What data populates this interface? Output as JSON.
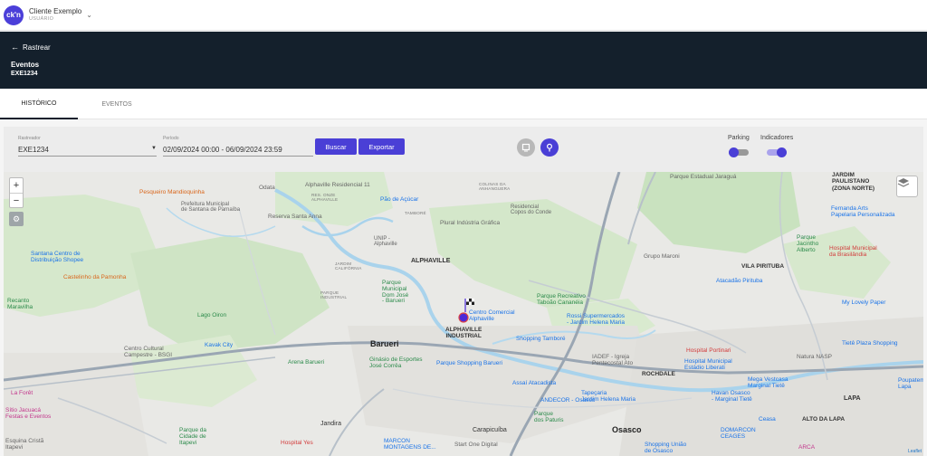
{
  "app": {
    "logo_text": "ck'n",
    "client_name": "Cliente Exemplo",
    "client_role": "USUÁRIO"
  },
  "header": {
    "back_label": "Rastrear",
    "title": "Eventos",
    "subtitle": "EXE1234"
  },
  "tabs": [
    {
      "label": "HISTÓRICO",
      "active": true
    },
    {
      "label": "EVENTOS",
      "active": false
    }
  ],
  "filters": {
    "tracker_label": "Rastreador",
    "tracker_value": "EXE1234",
    "period_label": "Período",
    "period_value": "02/09/2024 00:00 - 06/09/2024 23:59",
    "search_label": "Buscar",
    "export_label": "Exportar",
    "parking_label": "Parking",
    "parking_on": false,
    "indicators_label": "Indicadores",
    "indicators_on": true
  },
  "map": {
    "zoom_in": "+",
    "zoom_out": "−",
    "attribution": "Leaflet",
    "labels": {
      "pesqueiro": "Pesqueiro Mandioquinha",
      "prefeitura": "Prefeitura Municipal\nde Santana de Parnaíba",
      "reserva": "Reserva Santa Anna",
      "odata": "Odata",
      "alphaville11": "Alphaville Residencial 11",
      "resonze": "RES. ONZE\nALPHAVILLE",
      "paodeacucar": "Pão de Açúcar",
      "tambore": "TAMBORÉ",
      "residencial_conde": "Residencial\nCopos do Conde",
      "colinas": "COLINAS DA\nANHANGUERA",
      "plural": "Plural Indústria Gráfica",
      "unip": "UNIP -\nAlphaville",
      "alphaville": "ALPHAVILLE",
      "santana_centro": "Santana Centro de\nDistribuição Shopee",
      "castelinho": "Castelinho da Pamonha",
      "lago_oiron": "Lago Oiron",
      "recanto": "Recanto\nMaravilha",
      "parque_municipal": "Parque\nMunicipal\nDom José\n- Barueri",
      "alphaville_ind": "ALPHAVILLE\nINDUSTRIAL",
      "centro_comercial": "Centro Comercial\nAlphaville",
      "parque_recreativo": "Parque Recreativo\nTaboão Cananéia",
      "rossi": "Rossi Supermercados\n- Jardim Helena Maria",
      "shopping_tambore": "Shopping Tamboré",
      "kavak": "Kavak City",
      "centro_cultural": "Centro Cultural\nCampestre - BSGI",
      "barueri": "Barueri",
      "arena": "Arena Barueri",
      "ginasio": "Ginásio de Esportes\nJosé Corrêa",
      "parque_shopping": "Parque Shopping Barueri",
      "assai": "Assaí Atacadista",
      "andecor": "ANDECOR - Osasco",
      "tapeçaria": "Tapeçaria\nJardim Helena Maria",
      "iadef": "IADEF - Igreja\nPentecostal Ato",
      "hospital_portinari": "Hospital Portinari",
      "hospital_municipal": "Hospital Municipal\nEstádio Liberati",
      "parque_pituris": "Parque\ndos Paturis",
      "carapicuiba": "Carapicuíba",
      "jandira": "Jandira",
      "parque_cidade": "Parque da\nCidade de\nItapevi",
      "hospital_yes": "Hospital Yes",
      "marcon": "MARCON\nMONTAGENS DE...",
      "start_one": "Start One Digital",
      "osasco": "Osasco",
      "shopping_uniao": "Shopping União\nde Osasco",
      "domarcon": "DOMARCON\nCEAGES",
      "rochdale": "ROCHDALE",
      "grupo_maroni": "Grupo Maroni",
      "parque_jaragua": "Parque Estadual Jaraguá",
      "vila_piritu": "VILA PIRITUBA",
      "atacadao": "Atacadão Pirituba",
      "parque_jacintho": "Parque\nJacintho\nAlberto",
      "hospital_brasilandia": "Hospital Municipal\nda Brasilândia",
      "fernanda": "Fernanda Arts\nPapelaria Personalizada",
      "jardim_paulistano": "JARDIM\nPAULISTANO\n(ZONA NORTE)",
      "my_lovely": "My Lovely Paper",
      "tiete_plaza": "Tietê Plaza Shopping",
      "mega_vestcasa": "Mega Vestcasa\nMarginal Tietê",
      "havan": "Havan Osasco\n- Marginal Tietê",
      "ceasa": "Ceasa",
      "lapa": "LAPA",
      "alto_lapa": "ALTO DA LAPA",
      "arca": "ARCA",
      "poupatempo": "Poupatempo\nLapa",
      "natura": "Natura NASP",
      "la_fore": "La Forêt",
      "sitio": "Sítio Jacuacá\nFestas e Eventos",
      "esquina": "Esquina Cristã\nItapevi",
      "industrial": "PARQUE\nINDUSTRIAL",
      "vila_mercea": "JARDIM\nCALIFÓRNIA"
    }
  },
  "colors": {
    "accent": "#4a3fd6",
    "header_bg": "#14202c",
    "route": "#4b2ad8"
  }
}
